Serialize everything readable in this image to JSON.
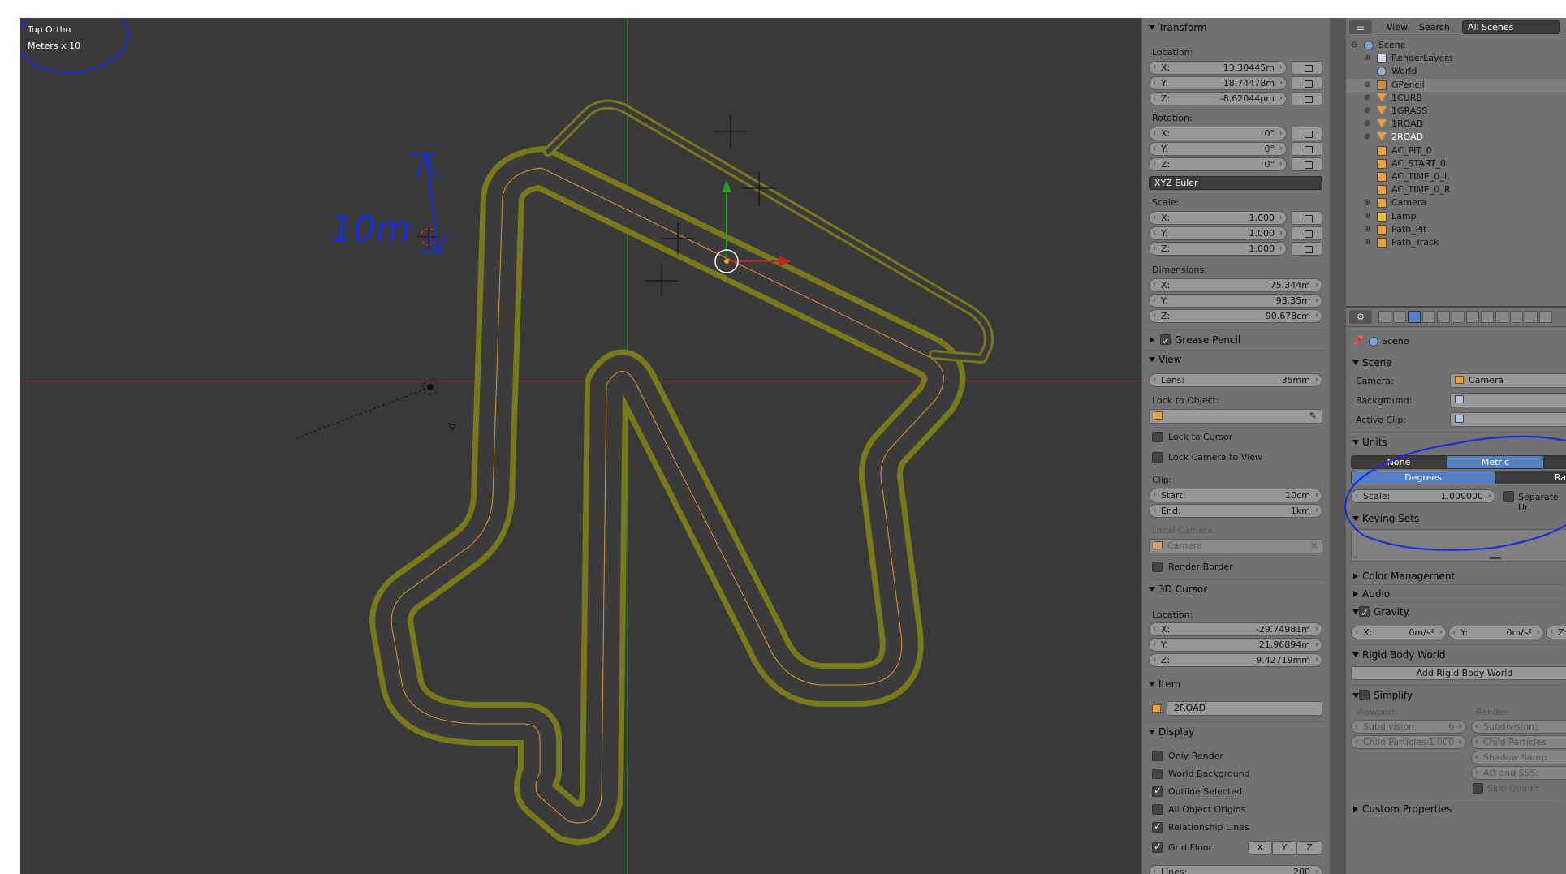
{
  "viewport": {
    "view_name": "Top Ortho",
    "scale_label": "Meters x 10",
    "annotation_text": "10m"
  },
  "n_panel": {
    "transform": {
      "title": "Transform",
      "location_label": "Location:",
      "location": {
        "x": "13.30445m",
        "y": "18.74478m",
        "z": "-8.62044µm"
      },
      "rotation_label": "Rotation:",
      "rotation": {
        "x": "0°",
        "y": "0°",
        "z": "0°"
      },
      "rotation_mode": "XYZ Euler",
      "scale_label": "Scale:",
      "scale": {
        "x": "1.000",
        "y": "1.000",
        "z": "1.000"
      },
      "dimensions_label": "Dimensions:",
      "dimensions": {
        "x": "75.344m",
        "y": "93.35m",
        "z": "90.678cm"
      }
    },
    "grease_pencil": {
      "title": "Grease Pencil"
    },
    "view": {
      "title": "View",
      "lens_label": "Lens:",
      "lens_value": "35mm",
      "lock_to_object_label": "Lock to Object:",
      "lock_to_cursor": "Lock to Cursor",
      "lock_camera_to_view": "Lock Camera to View",
      "clip_label": "Clip:",
      "clip_start_label": "Start:",
      "clip_start": "10cm",
      "clip_end_label": "End:",
      "clip_end": "1km",
      "local_camera_label": "Local Camera:",
      "local_camera": "Camera",
      "render_border": "Render Border"
    },
    "cursor": {
      "title": "3D Cursor",
      "location_label": "Location:",
      "location": {
        "x": "-29.74981m",
        "y": "21.96894m",
        "z": "9.42719mm"
      }
    },
    "item": {
      "title": "Item",
      "name": "2ROAD"
    },
    "display": {
      "title": "Display",
      "only_render": "Only Render",
      "world_background": "World Background",
      "outline_selected": "Outline Selected",
      "all_object_origins": "All Object Origins",
      "relationship_lines": "Relationship Lines",
      "grid_floor": "Grid Floor",
      "axis_x": "X",
      "axis_y": "Y",
      "axis_z": "Z",
      "lines_label": "Lines:",
      "lines_value": "200"
    },
    "axis_labels": {
      "x": "X:",
      "y": "Y:",
      "z": "Z:"
    }
  },
  "outliner": {
    "menu_view": "View",
    "menu_search": "Search",
    "scenes_dropdown": "All Scenes",
    "items": [
      {
        "label": "Scene",
        "icon": "scene-icon",
        "indent": 0
      },
      {
        "label": "RenderLayers",
        "icon": "renderlayers-icon",
        "indent": 1
      },
      {
        "label": "World",
        "icon": "world-icon",
        "indent": 1
      },
      {
        "label": "GPencil",
        "icon": "gpencil-icon",
        "indent": 1
      },
      {
        "label": "1CURB",
        "icon": "mesh-icon",
        "indent": 1
      },
      {
        "label": "1GRASS",
        "icon": "mesh-icon",
        "indent": 1
      },
      {
        "label": "1ROAD",
        "icon": "mesh-icon",
        "indent": 1
      },
      {
        "label": "2ROAD",
        "icon": "mesh-icon",
        "indent": 1
      },
      {
        "label": "AC_PIT_0",
        "icon": "empty-icon",
        "indent": 1
      },
      {
        "label": "AC_START_0",
        "icon": "empty-icon",
        "indent": 1
      },
      {
        "label": "AC_TIME_0_L",
        "icon": "empty-icon",
        "indent": 1
      },
      {
        "label": "AC_TIME_0_R",
        "icon": "empty-icon",
        "indent": 1
      },
      {
        "label": "Camera",
        "icon": "camera-icon",
        "indent": 1
      },
      {
        "label": "Lamp",
        "icon": "lamp-icon",
        "indent": 1
      },
      {
        "label": "Path_Pit",
        "icon": "curve-icon",
        "indent": 1
      },
      {
        "label": "Path_Track",
        "icon": "curve-icon",
        "indent": 1
      }
    ]
  },
  "properties": {
    "context": "Scene",
    "scene_panel": {
      "title": "Scene",
      "camera_label": "Camera:",
      "camera_value": "Camera",
      "background_label": "Background:",
      "active_clip_label": "Active Clip:"
    },
    "units_panel": {
      "title": "Units",
      "none": "None",
      "metric": "Metric",
      "degrees": "Degrees",
      "radians_partial": "Ra",
      "scale_label": "Scale:",
      "scale_value": "1.000000",
      "separate_units": "Separate Un"
    },
    "keying_sets": {
      "title": "Keying Sets"
    },
    "color_management": {
      "title": "Color Management"
    },
    "audio": {
      "title": "Audio"
    },
    "gravity": {
      "title": "Gravity",
      "x_label": "X:",
      "x": "0m/s²",
      "y_label": "Y:",
      "y": "0m/s²",
      "z_label": "Z:"
    },
    "rigid_body": {
      "title": "Rigid Body World",
      "add_button": "Add Rigid Body World"
    },
    "simplify": {
      "title": "Simplify",
      "viewport_label": "Viewport:",
      "render_label": "Render:",
      "subdivision_label": "Subdivision:",
      "subdivision_value": "6",
      "child_particles_label": "Child Particles:",
      "child_particles_value": "1.000",
      "render_subdivision": "Subdivision:",
      "render_child_particles": "Child Particles",
      "shadow_samples": "Shadow Samp",
      "ao_sss": "AO and SSS:",
      "skip_quad": "Skip Quad t"
    },
    "custom_properties": {
      "title": "Custom Properties"
    }
  },
  "colors": {
    "viewport_bg": "#393939",
    "panel_bg": "#727272",
    "track_grass": "#787a1a",
    "road": "#3b3b3b",
    "selection_orange": "#f0a030",
    "annotation_blue": "#1a2fd9",
    "axis_red": "#a22222",
    "axis_green": "#2d9a2d",
    "selected_blue": "#5680c2"
  }
}
